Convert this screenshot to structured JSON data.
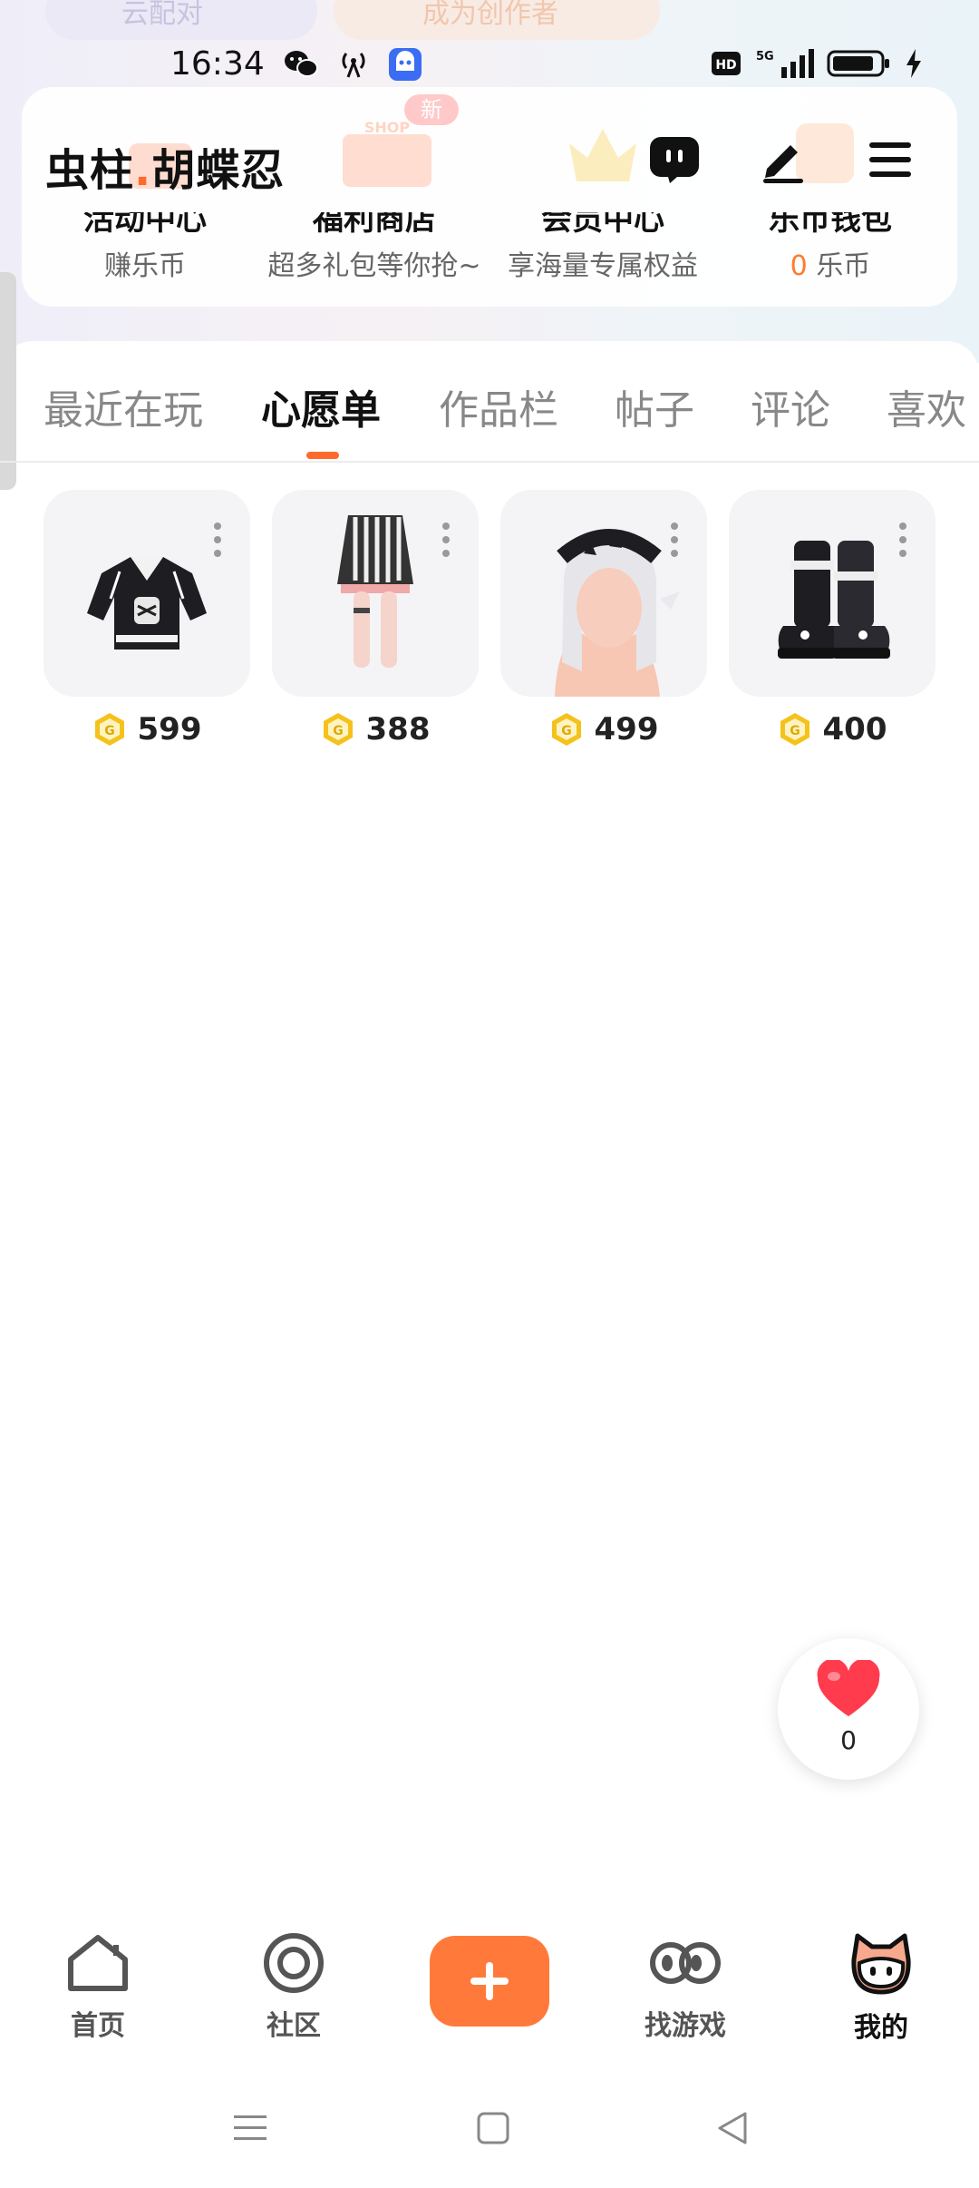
{
  "status_bar": {
    "time": "16:34",
    "network": "5G",
    "hd_label": "HD"
  },
  "peek_banners": [
    "云配对",
    "成为创作者"
  ],
  "header": {
    "username_part1": "虫柱",
    "username_dot": ".",
    "username_part2": "胡蝶忍",
    "new_badge": "新",
    "shop_sign": "SHOP"
  },
  "quick_links": [
    {
      "title": "活动中心",
      "sub": "赚乐币"
    },
    {
      "title": "福利商店",
      "sub": "超多礼包等你抢~"
    },
    {
      "title": "会员中心",
      "sub": "享海量专属权益"
    },
    {
      "title": "乐币钱包",
      "sub_num": "0",
      "sub": "乐币"
    }
  ],
  "tabs": [
    "最近在玩",
    "心愿单",
    "作品栏",
    "帖子",
    "评论",
    "喜欢"
  ],
  "active_tab": "心愿单",
  "wishlist": [
    {
      "item": "jacket",
      "price": "599"
    },
    {
      "item": "skirt",
      "price": "388"
    },
    {
      "item": "hair",
      "price": "499"
    },
    {
      "item": "boots",
      "price": "400"
    }
  ],
  "like_fab": {
    "count": "0"
  },
  "bottom_nav": [
    {
      "label": "首页",
      "icon": "home-icon"
    },
    {
      "label": "社区",
      "icon": "community-icon"
    },
    {
      "label": "",
      "icon": "plus-icon"
    },
    {
      "label": "找游戏",
      "icon": "find-game-icon"
    },
    {
      "label": "我的",
      "icon": "profile-mascot-icon"
    }
  ],
  "colors": {
    "accent": "#ff6a2c",
    "coin": "#f5c21b",
    "heart": "#ff3b4d"
  }
}
